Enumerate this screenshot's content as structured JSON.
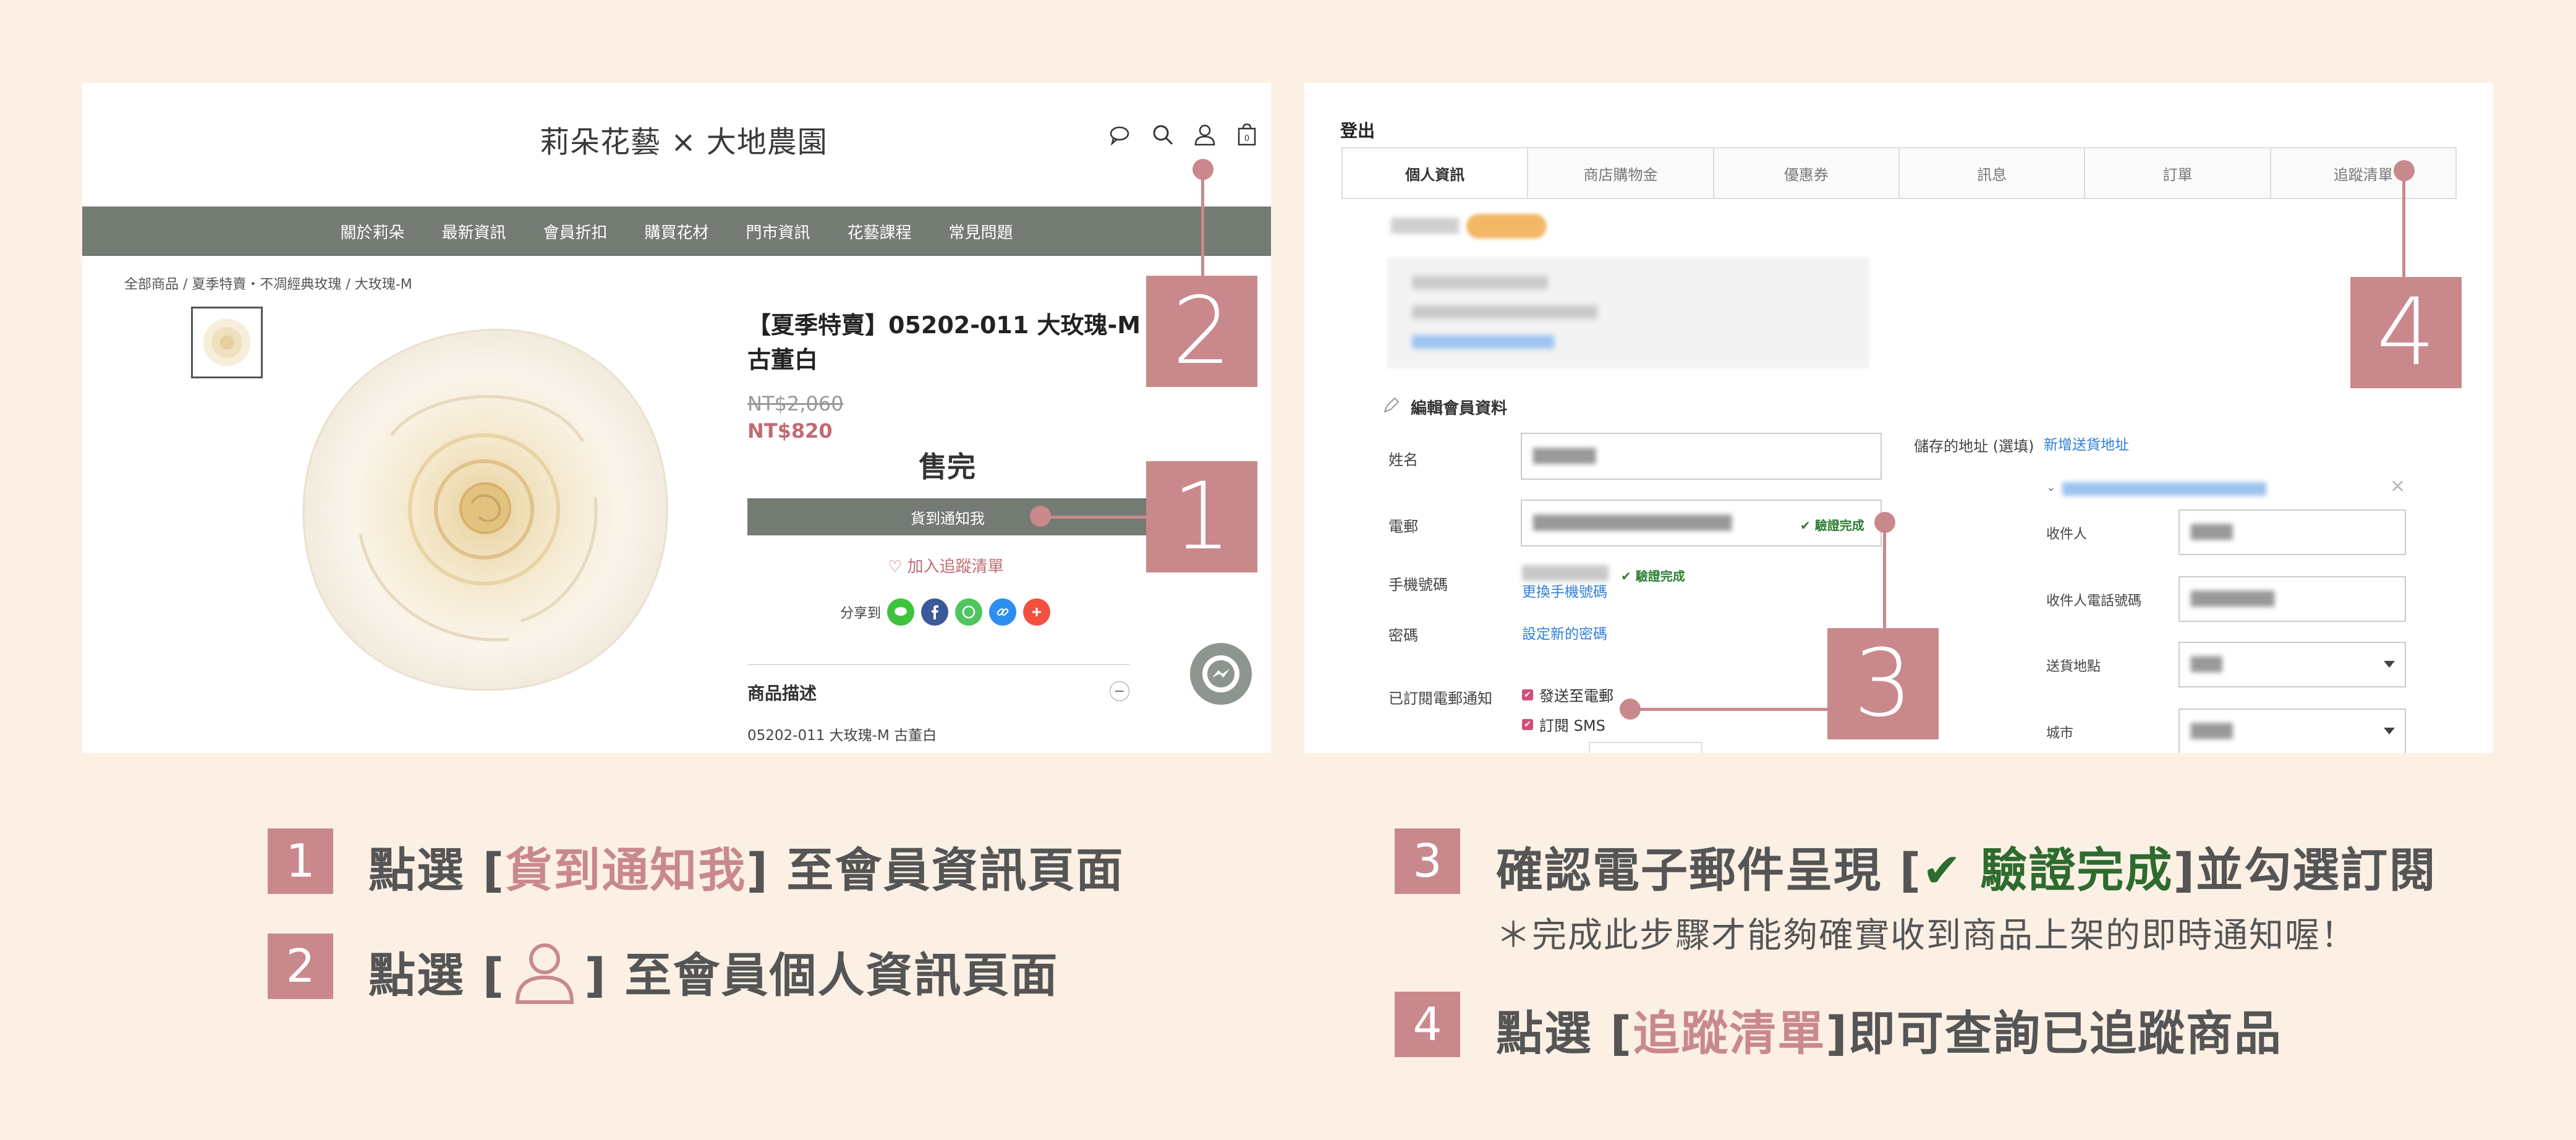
{
  "left_panel": {
    "brand": "莉朵花藝 × 大地農園",
    "nav": [
      "關於莉朵",
      "最新資訊",
      "會員折扣",
      "購買花材",
      "門市資訊",
      "花藝課程",
      "常見問題"
    ],
    "breadcrumb": "全部商品 / 夏季特賣・不凋經典玫瑰 / 大玫瑰-M",
    "product_title": "【夏季特賣】05202-011 大玫瑰-M 古董白",
    "old_price": "NT$2,060",
    "new_price": "NT$820",
    "sold_out": "售完",
    "notify_button": "貨到通知我",
    "wishlist_link": "♡ 加入追蹤清單",
    "share_label": "分享到",
    "description_title": "商品描述",
    "description_toggle": "−",
    "description_text": "05202-011 大玫瑰-M 古董白"
  },
  "right_panel": {
    "logout": "登出",
    "tabs": [
      "個人資訊",
      "商店購物金",
      "優惠券",
      "訊息",
      "訂單",
      "追蹤清單"
    ],
    "edit_section_title": "編輯會員資料",
    "fields": {
      "name_label": "姓名",
      "email_label": "電郵",
      "email_verified": "✔ 驗證完成",
      "phone_label": "手機號碼",
      "phone_verified": "✔ 驗證完成",
      "phone_change_link": "更換手機號碼",
      "password_label": "密碼",
      "password_link": "設定新的密碼",
      "subscribe_label": "已訂閱電郵通知",
      "subscribe_email": "發送至電郵",
      "subscribe_sms": "訂閱 SMS"
    },
    "address": {
      "saved_label": "儲存的地址 (選填)",
      "add_link": "新增送貨地址",
      "recipient_label": "收件人",
      "recipient_phone_label": "收件人電話號碼",
      "region_label": "送貨地點",
      "city_label": "城市"
    }
  },
  "callouts": [
    "1",
    "2",
    "3",
    "4"
  ],
  "instructions": {
    "step1": {
      "num": "1",
      "pre": "點選 [",
      "highlight": "貨到通知我",
      "post": "] 至會員資訊頁面"
    },
    "step2": {
      "num": "2",
      "pre": "點選 [",
      "post": "] 至會員個人資訊頁面"
    },
    "step3": {
      "num": "3",
      "pre": "確認電子郵件呈現 [",
      "highlight": "✔ 驗證完成",
      "post": "]並勾選訂閱",
      "note": "＊完成此步驟才能夠確實收到商品上架的即時通知喔！"
    },
    "step4": {
      "num": "4",
      "pre": "點選 [",
      "highlight": "追蹤清單",
      "post": "]即可查詢已追蹤商品"
    }
  },
  "colors": {
    "accent": "#c9898c",
    "nav_bg": "#737b73",
    "background": "#fcf0e5",
    "verified": "#2e7d32"
  }
}
